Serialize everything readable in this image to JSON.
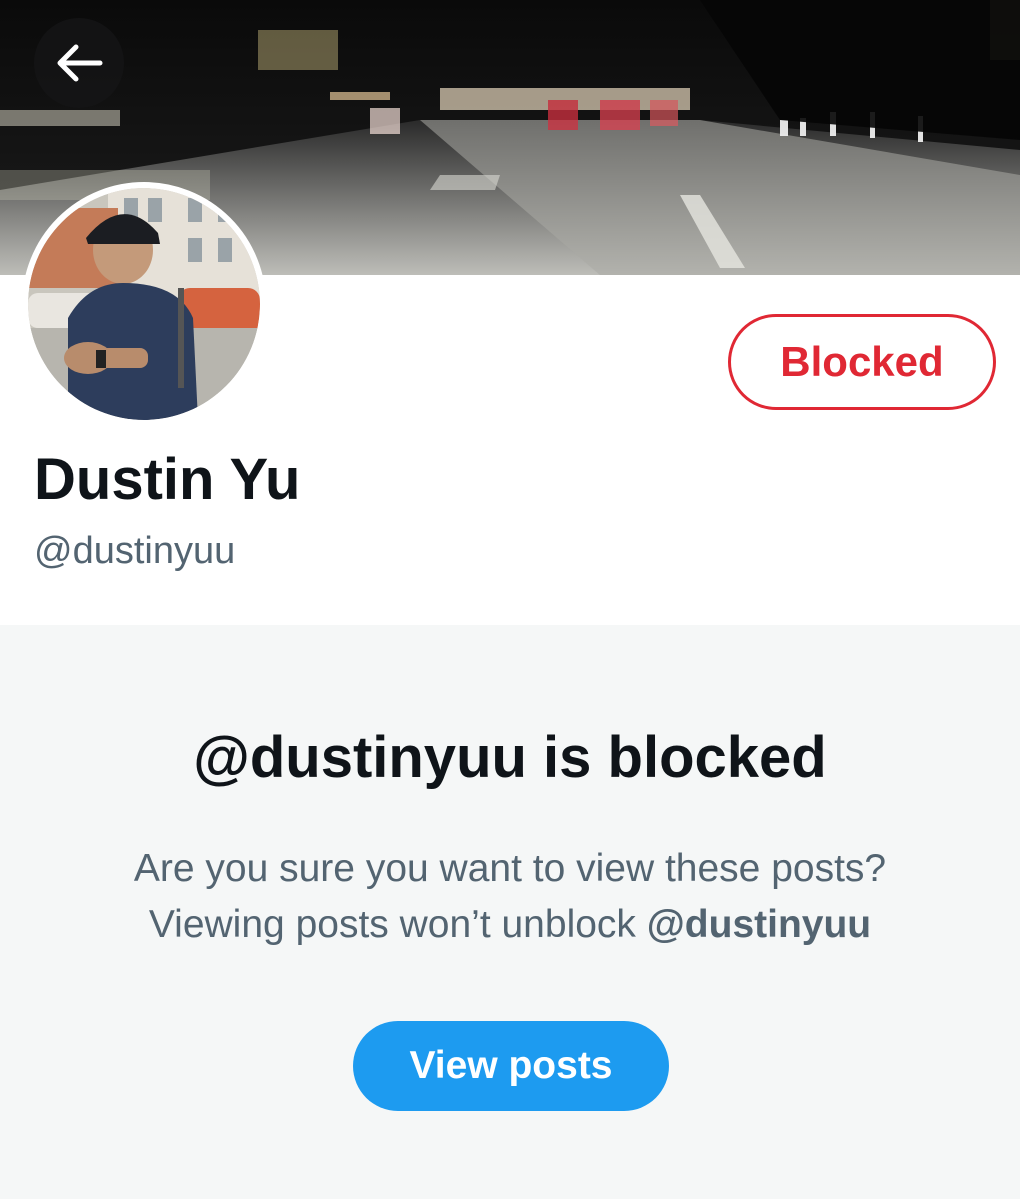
{
  "header": {
    "back_icon": "arrow-left-icon"
  },
  "profile": {
    "display_name": "Dustin Yu",
    "handle": "@dustinyuu",
    "blocked_label": "Blocked",
    "blocked_color": "#e02834"
  },
  "notice": {
    "title": "@dustinyuu is blocked",
    "line1": "Are you sure you want to view these posts?",
    "line2_prefix": "Viewing posts won’t unblock ",
    "line2_handle": "@dustinyuu",
    "view_posts_label": "View posts",
    "button_color": "#1d9bf0"
  }
}
